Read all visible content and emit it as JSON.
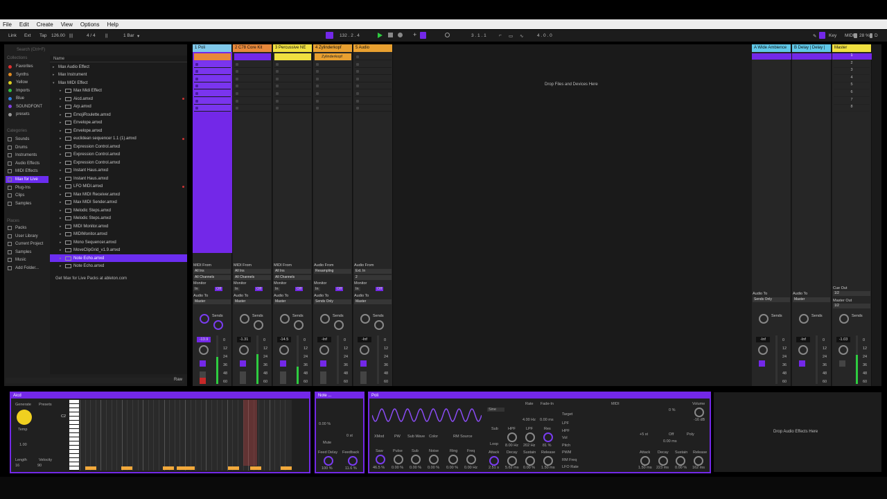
{
  "menu": [
    "File",
    "Edit",
    "Create",
    "View",
    "Options",
    "Help"
  ],
  "transport": {
    "link": "Link",
    "ext": "Ext",
    "tap": "Tap",
    "tempo": "126.00",
    "sig": "4 / 4",
    "quant": "1 Bar",
    "position": "132 .  2 .  4",
    "loop_start": "3 .  1 .  1",
    "loop_len": "4 .  0 .  0",
    "key": "Key",
    "midi": "MIDI",
    "cpu": "28 %",
    "d": "D"
  },
  "browser": {
    "search": "Search (Ctrl+F)",
    "collections_label": "Collections",
    "collections": [
      {
        "label": "Favorites",
        "color": "#e03030"
      },
      {
        "label": "Synths",
        "color": "#e08a20"
      },
      {
        "label": "Yellow",
        "color": "#e0d020"
      },
      {
        "label": "Imports",
        "color": "#30c040"
      },
      {
        "label": "Blue",
        "color": "#3080e0"
      },
      {
        "label": "SOUNDFONT",
        "color": "#8040e0"
      },
      {
        "label": "presets",
        "color": "#999999"
      }
    ],
    "categories_label": "Categories",
    "categories": [
      "Sounds",
      "Drums",
      "Instruments",
      "Audio Effects",
      "MIDI Effects",
      "Max for Live",
      "Plug-Ins",
      "Clips",
      "Samples"
    ],
    "places_label": "Places",
    "places": [
      "Packs",
      "User Library",
      "Current Project",
      "Samples",
      "Music",
      "Add Folder..."
    ],
    "name_header": "Name",
    "files": [
      {
        "label": "Max Audio Effect",
        "type": "folder",
        "indent": 0
      },
      {
        "label": "Max Instrument",
        "type": "folder",
        "indent": 0
      },
      {
        "label": "Max MIDI Effect",
        "type": "open",
        "indent": 0
      },
      {
        "label": "Max Midi Effect",
        "type": "file",
        "indent": 1
      },
      {
        "label": "Aicd.amxd",
        "type": "file",
        "indent": 1,
        "red": true
      },
      {
        "label": "Arp.amxd",
        "type": "file",
        "indent": 1
      },
      {
        "label": "EmojiRoulette.amxd",
        "type": "file",
        "indent": 1
      },
      {
        "label": "Envelope.amxd",
        "type": "file",
        "indent": 1
      },
      {
        "label": "Envelope.amxd",
        "type": "file",
        "indent": 1
      },
      {
        "label": "euclidean sequencer 1.1 (1).amxd",
        "type": "file",
        "indent": 1,
        "red": true
      },
      {
        "label": "Expression Control.amxd",
        "type": "file",
        "indent": 1
      },
      {
        "label": "Expression Control.amxd",
        "type": "file",
        "indent": 1
      },
      {
        "label": "Expression Control.amxd",
        "type": "file",
        "indent": 1
      },
      {
        "label": "Instant Haus.amxd",
        "type": "file",
        "indent": 1
      },
      {
        "label": "Instant Haus.amxd",
        "type": "file",
        "indent": 1
      },
      {
        "label": "LFO MIDI.amxd",
        "type": "file",
        "indent": 1,
        "red": true
      },
      {
        "label": "Max MIDI Receiver.amxd",
        "type": "file",
        "indent": 1
      },
      {
        "label": "Max MIDI Sender.amxd",
        "type": "file",
        "indent": 1
      },
      {
        "label": "Melodic Steps.amxd",
        "type": "file",
        "indent": 1
      },
      {
        "label": "Melodic Steps.amxd",
        "type": "file",
        "indent": 1
      },
      {
        "label": "MIDI Monitor.amxd",
        "type": "file",
        "indent": 1
      },
      {
        "label": "MIDIMonitor.amxd",
        "type": "file",
        "indent": 1
      },
      {
        "label": "Mono Sequencer.amxd",
        "type": "file",
        "indent": 1
      },
      {
        "label": "MoveClipGrid_v1.9.amxd",
        "type": "file",
        "indent": 1
      },
      {
        "label": "Note Echo.amxd",
        "type": "file",
        "indent": 1,
        "selected": true
      },
      {
        "label": "Note Echo.amxd",
        "type": "file",
        "indent": 1
      }
    ],
    "footer": "Get Max for Live Packs at ableton.com",
    "raw": "Raw"
  },
  "tracks": [
    {
      "title": "1 Poli",
      "color": "#7fc8ea",
      "clip_color": "#7328e8",
      "io_from": "MIDI From",
      "from": "All Ins",
      "ch": "All Channels",
      "monitor": "Monitor",
      "audio_to": "Audio To",
      "to": "Master",
      "vol": "-13.9",
      "meter": 0.55
    },
    {
      "title": "2 C78 Core Kit",
      "color": "#e8883a",
      "io_from": "MIDI From",
      "from": "All Ins",
      "ch": "All Channels",
      "monitor": "Monitor",
      "audio_to": "Audio To",
      "to": "Master",
      "vol": "-1.31",
      "meter": 0.62
    },
    {
      "title": "3 Percussive NE",
      "color": "#f0e040",
      "io_from": "MIDI From",
      "from": "All Ins",
      "ch": "All Channels",
      "monitor": "Monitor",
      "audio_to": "Audio To",
      "to": "Master",
      "vol": "-14.5",
      "meter": 0.35
    },
    {
      "title": "4 Zylinderkopf",
      "color": "#e8a030",
      "io_from": "Audio From",
      "from": "Resampling",
      "ch": "",
      "monitor": "Monitor",
      "audio_to": "Audio To",
      "to": "Sends Only",
      "vol": "-Inf",
      "meter": 0
    },
    {
      "title": "5 Audio",
      "color": "#e8a030",
      "io_from": "Audio From",
      "from": "Ext. In",
      "ch": "2",
      "monitor": "Monitor",
      "audio_to": "Audio To",
      "to": "Master",
      "vol": "-Inf",
      "meter": 0
    }
  ],
  "returns": [
    {
      "title": "A Wide Ambience",
      "color": "#60c8e8",
      "to": "Sends Only",
      "vol": "-Inf"
    },
    {
      "title": "B Delay | Delay |",
      "color": "#60c8e8",
      "to": "Master",
      "vol": "-Inf"
    },
    {
      "title": "Master",
      "color": "#f0e040",
      "to": "",
      "vol": "-1.03"
    }
  ],
  "clip_names": {
    "track4": "Zylinderkopf"
  },
  "session_drop": "Drop Files and Devices Here",
  "scenes": [
    "1",
    "2",
    "3",
    "4",
    "5",
    "6",
    "7",
    "8"
  ],
  "sends": "Sends",
  "audio_to": "Audio To",
  "cue_out": "Cue Out",
  "cue_val": "1/2",
  "master_out": "Master Out",
  "master_val": "1/2",
  "scale": [
    "0",
    "12",
    "24",
    "36",
    "48",
    "60"
  ],
  "in_label": "In",
  "auto_label": "Auto",
  "off_label": "Off",
  "devices": {
    "aicd": {
      "title": "Aicd",
      "generate": "Generate",
      "presets": "Presets",
      "temp": "Temp",
      "temp_val": "1.00",
      "length": "Length",
      "velocity": "Velocity",
      "len_val": "16",
      "vel_val": "90",
      "note": "C2"
    },
    "note": {
      "title": "Note ...",
      "mute": "Mute",
      "feed_delay": "Feed Delay",
      "feedback": "Feedback",
      "fd_val": "100 %",
      "fb_val": "11.6 %",
      "pct": "0.00 %",
      "st": "0 st"
    },
    "poli": {
      "title": "Poli",
      "xmod": "XMod",
      "pw": "PW",
      "sub_wave": "Sub Wave",
      "color": "Color",
      "rm_source": "RM Source",
      "saw": "Saw",
      "pulse": "Pulse",
      "sub": "Sub",
      "noise": "Noise",
      "ring": "Ring",
      "freq": "Freq",
      "v_saw": "46.5 %",
      "v_pulse": "0.00 %",
      "v_sub": "0.00 %",
      "v_noise": "0.00 %",
      "v_ring": "0.00 %",
      "v_freq": "0.00 Hz",
      "rate": "Rate",
      "fade_in": "Fade-In",
      "sine": "Sine",
      "rate_val": "4.00 Hz",
      "fade_val": "0.00 ms",
      "hpf": "HPF",
      "lpf": "LPF",
      "res": "Res",
      "hpf_val": "8.00 Hz",
      "lpf_val": "202 Hz",
      "res_val": "81 %",
      "loop": "Loop",
      "attack": "Attack",
      "decay": "Decay",
      "sustain": "Sustain",
      "release": "Release",
      "a_val": "2.51 s",
      "d_val": "5.62 ms",
      "s_val": "0.00 %",
      "r_val": "1.50 ms",
      "midi": "MIDI",
      "target": "Target",
      "targets": [
        "LPF",
        "HPF",
        "Vol",
        "Pitch",
        "PWM",
        "RM Freq",
        "LFO Rate"
      ],
      "volume": "Volume",
      "vol_val": "-16 dB",
      "off": "Off",
      "poly": "Poly",
      "st_val": "+5 st",
      "ms_val": "0.00 ms",
      "a2": "1.50 ms",
      "d2": "223 ms",
      "s2": "0.00 %",
      "r2": "162 ms",
      "pct": "0 %"
    },
    "drop": "Drop Audio Effects Here"
  }
}
